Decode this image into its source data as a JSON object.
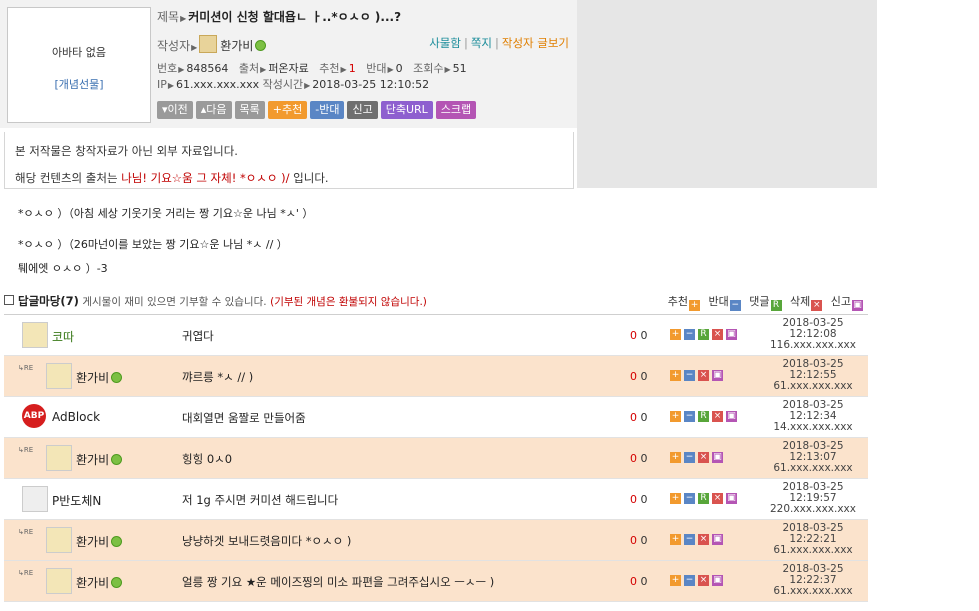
{
  "post": {
    "avatar_none": "아바타 없음",
    "avatar_gift": "[개념선물]",
    "title_label": "제목",
    "title": "커미션이 신청 할대욥ㄴ ㅏ..*ㅇㅅㅇ )...?",
    "author_label": "작성자",
    "author": "환가비",
    "links": {
      "blacklist": "사물함",
      "message": "쪽지",
      "author_posts": "작성자 글보기"
    },
    "number_label": "번호",
    "number": "848564",
    "source_label": "출처",
    "source": "퍼온자료",
    "recommend_label": "추천",
    "recommend": "1",
    "oppose_label": "반대",
    "oppose": "0",
    "views_label": "조회수",
    "views": "51",
    "ip_label": "IP",
    "ip": "61.xxx.xxx.xxx",
    "time_label": "작성시간",
    "time": "2018-03-25 12:10:52"
  },
  "buttons": {
    "prev": "▾이전",
    "next": "▴다음",
    "list": "목록",
    "recommend": "+추천",
    "oppose": "-반대",
    "report": "신고",
    "short_url": "단축URL",
    "scrap": "스크랩"
  },
  "notice": {
    "line1": "본 저작물은 창작자료가 아닌 외부 자료입니다.",
    "line2_prefix": "해당 컨텐츠의 출처는",
    "line2_source": "나님! 기요☆움 그 자체! *ㅇㅅㅇ )/",
    "line2_suffix": "입니다."
  },
  "body": [
    "*ㅇㅅㅇ ）（아침 세상 기웃기웃 거리는 짱 기요☆운 나님 *ㅅ' ）",
    "*ㅇㅅㅇ ）（26마넌이를 보았는 짱 기요☆운 나님 *ㅅ // ）",
    "퉤에엣 ㅇㅅㅇ ）-3"
  ],
  "reply_section": {
    "title": "답글마당",
    "count": "(7)",
    "desc": "게시물이 재미 있으면 기부할 수 있습니다.",
    "warn": "(기부된 개념은 환불되지 않습니다.)",
    "legend": {
      "recommend": "추천",
      "oppose": "반대",
      "reply": "댓글",
      "delete": "삭제",
      "report": "신고"
    }
  },
  "replies": [
    {
      "name": "코따",
      "text": "귀엽다",
      "up": "0",
      "down": "0",
      "date": "2018-03-25",
      "time": "12:12:08",
      "ip": "116.xxx.xxx.xxx"
    },
    {
      "name": "환가비",
      "text": "꺄르릉 *ㅅ // )",
      "up": "0",
      "down": "0",
      "date": "2018-03-25",
      "time": "12:12:55",
      "ip": "61.xxx.xxx.xxx"
    },
    {
      "name": "AdBlock",
      "text": "대회열면 움짤로 만들어줌",
      "up": "0",
      "down": "0",
      "date": "2018-03-25",
      "time": "12:12:34",
      "ip": "14.xxx.xxx.xxx"
    },
    {
      "name": "환가비",
      "text": "힝힝 0ㅅ0",
      "up": "0",
      "down": "0",
      "date": "2018-03-25",
      "time": "12:13:07",
      "ip": "61.xxx.xxx.xxx"
    },
    {
      "name": "P반도체N",
      "text": "저 1g 주시면 커미션 해드립니다",
      "up": "0",
      "down": "0",
      "date": "2018-03-25",
      "time": "12:19:57",
      "ip": "220.xxx.xxx.xxx"
    },
    {
      "name": "환가비",
      "text": "냥냥하겟 보내드렷음미다 *ㅇㅅㅇ )",
      "up": "0",
      "down": "0",
      "date": "2018-03-25",
      "time": "12:22:21",
      "ip": "61.xxx.xxx.xxx"
    },
    {
      "name": "환가비",
      "text": "얼릉 짱 기요 ★운 메이즈찡의 미소 파편을 그려주십시오 ㅡㅅㅡ )",
      "up": "0",
      "down": "0",
      "date": "2018-03-25",
      "time": "12:22:37",
      "ip": "61.xxx.xxx.xxx"
    }
  ],
  "icons": {
    "status": "online-dot-icon",
    "reply_marker": "reply-arrow-icon",
    "adblock": "adblock-logo"
  },
  "colors": {
    "accent_orange": "#f29a2e",
    "accent_blue": "#5a86c5",
    "reply_row_bg": "#fbe3cc",
    "link_teal": "#1a8c9a"
  }
}
